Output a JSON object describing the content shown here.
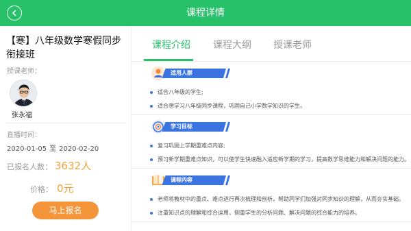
{
  "header": {
    "title": "课程详情",
    "back_icon": "chevron-left-icon"
  },
  "course": {
    "name": "【寒】八年级数学寒假同步衔接班",
    "teacher_label": "授课老师：",
    "teacher_name": "张永福",
    "time_label": "直播时间：",
    "start_date": "2020-01-05",
    "to_text": "至",
    "end_date": "2020-02-20",
    "enrolled_label": "已报名人数：",
    "enrolled_count": "3632人",
    "price_label": "价格：",
    "price": "0元",
    "signup_label": "马上报名"
  },
  "tabs": [
    {
      "label": "课程介绍",
      "active": true
    },
    {
      "label": "课程大纲",
      "active": false
    },
    {
      "label": "授课老师",
      "active": false
    }
  ],
  "sections": [
    {
      "title": "适用人群",
      "icon": "person-icon",
      "items": [
        "适合八年级的学生;",
        "适合想学习八年级同步课程，巩固自己小学数学知识的学生。"
      ]
    },
    {
      "title": "学习目标",
      "icon": "target-icon",
      "items": [
        "复习巩固上学期重难点内容;",
        "预习新学期重难点知识，可以使学生快速融入适应新学期的学习，提高数学思维能力和解决问题的能力。"
      ]
    },
    {
      "title": "课程内容",
      "icon": "book-icon",
      "items": [
        "老师将教材中的重点、难点进行再次梳理和剖析，帮助同学们加强对同步知识的理解，从而夯实基础。",
        "注重知识点的理解和综合运用，侧重学生的分析问题、解决问题的综合能力的培养。"
      ]
    }
  ],
  "colors": {
    "brand_green": "#27c16a",
    "accent_orange": "#f4953a",
    "section_blue": "#3b73e0"
  }
}
